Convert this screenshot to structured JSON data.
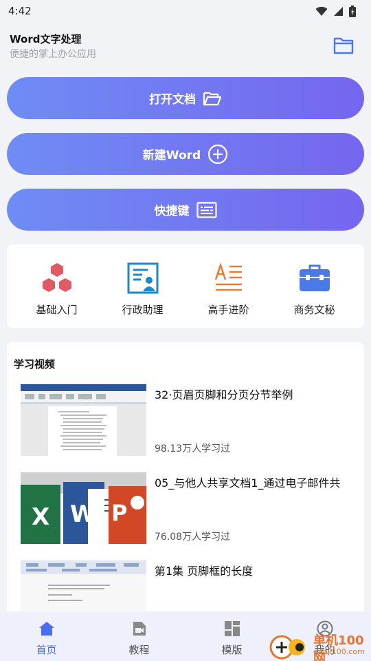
{
  "status": {
    "time": "4:42"
  },
  "header": {
    "title": "Word文字处理",
    "subtitle": "便捷的掌上办公应用"
  },
  "actions": [
    {
      "label": "打开文档",
      "icon": "folder-open-icon"
    },
    {
      "label": "新建Word",
      "icon": "plus-circle-icon"
    },
    {
      "label": "快捷键",
      "icon": "keyboard-icon"
    }
  ],
  "categories": [
    {
      "label": "基础入门",
      "icon": "hexagons-icon",
      "color": "#e05a64"
    },
    {
      "label": "行政助理",
      "icon": "id-card-icon",
      "color": "#1b89c9"
    },
    {
      "label": "高手进阶",
      "icon": "text-align-icon",
      "color": "#f07b30"
    },
    {
      "label": "商务文秘",
      "icon": "briefcase-icon",
      "color": "#4a7ae8"
    }
  ],
  "videos": {
    "title": "学习视频",
    "items": [
      {
        "title": "32·页眉页脚和分页分节举例",
        "count": "98.13万人学习过"
      },
      {
        "title": "05_与他人共享文档1_通过电子邮件共",
        "count": "76.08万人学习过"
      },
      {
        "title": "第1集 页脚框的长度",
        "count": ""
      }
    ]
  },
  "nav": [
    {
      "label": "首页",
      "icon": "home-icon"
    },
    {
      "label": "教程",
      "icon": "video-icon"
    },
    {
      "label": "模版",
      "icon": "template-icon"
    },
    {
      "label": "我的",
      "icon": "user-icon"
    }
  ],
  "watermark": {
    "text": "单机100网",
    "url": "danji100.com"
  },
  "colors": {
    "accent": "#4a6cf0",
    "gradient_start": "#6f8cf4",
    "gradient_end": "#7566ef"
  }
}
